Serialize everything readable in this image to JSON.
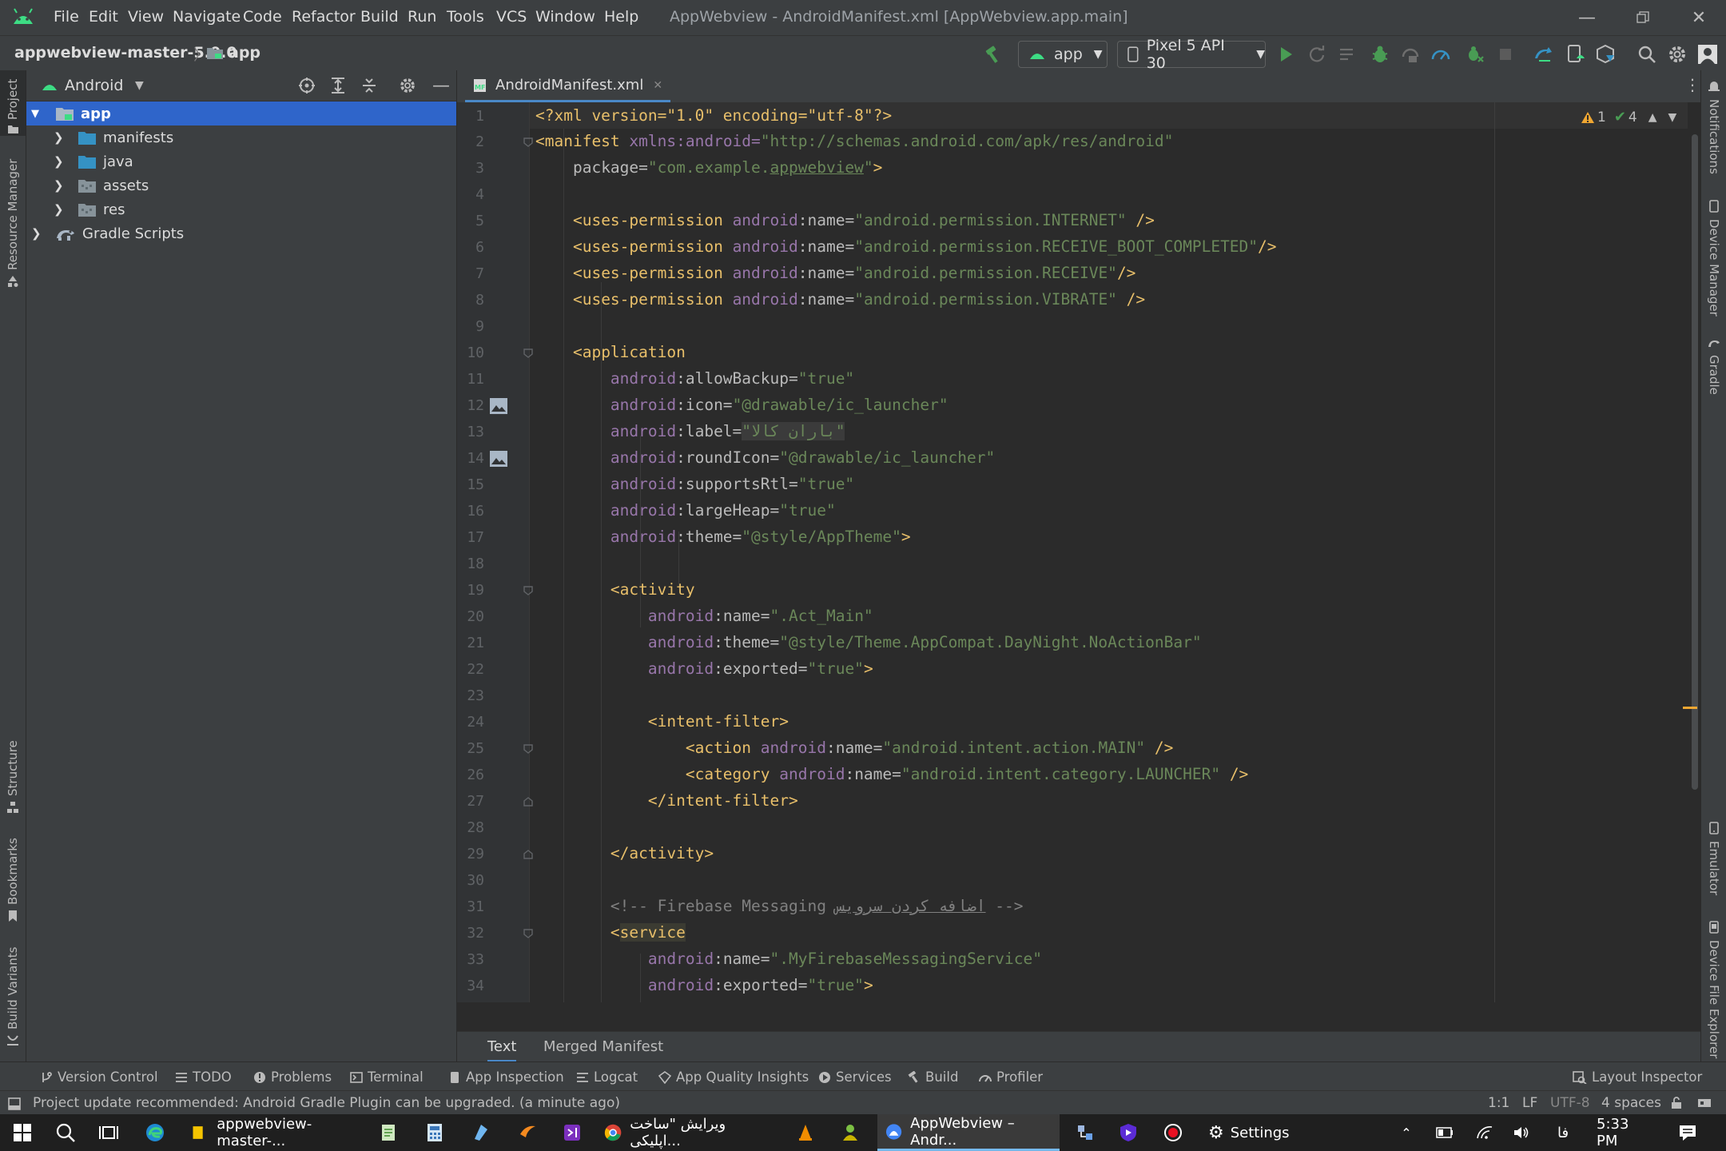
{
  "menu": [
    "File",
    "Edit",
    "View",
    "Navigate",
    "Code",
    "Refactor",
    "Build",
    "Run",
    "Tools",
    "VCS",
    "Window",
    "Help"
  ],
  "window_title": "AppWebview - AndroidManifest.xml [AppWebview.app.main]",
  "breadcrumb": {
    "root": "appwebview-master-5.0.0",
    "module": "app"
  },
  "run_config": "app",
  "device": "Pixel 5 API 30",
  "project_view": "Android",
  "tree": [
    {
      "label": "app",
      "depth": 0,
      "kind": "module",
      "expanded": true,
      "selected": true
    },
    {
      "label": "manifests",
      "depth": 1,
      "kind": "folder"
    },
    {
      "label": "java",
      "depth": 1,
      "kind": "folder"
    },
    {
      "label": "assets",
      "depth": 1,
      "kind": "folder-gray"
    },
    {
      "label": "res",
      "depth": 1,
      "kind": "folder-gray"
    },
    {
      "label": "Gradle Scripts",
      "depth": 0,
      "kind": "gradle"
    }
  ],
  "left_stripe": [
    "Project",
    "Resource Manager",
    "Structure",
    "Bookmarks",
    "Build Variants"
  ],
  "right_stripe": [
    "Notifications",
    "Device Manager",
    "Gradle",
    "Emulator",
    "Device File Explorer"
  ],
  "editor_tab": "AndroidManifest.xml",
  "inspection": {
    "warnings": "1",
    "checks": "4"
  },
  "code_lines": [
    "1",
    "2",
    "3",
    "4",
    "5",
    "6",
    "7",
    "8",
    "9",
    "10",
    "11",
    "12",
    "13",
    "14",
    "15",
    "16",
    "17",
    "18",
    "19",
    "20",
    "21",
    "22",
    "23",
    "24",
    "25",
    "26",
    "27",
    "28",
    "29",
    "30",
    "31",
    "32",
    "33",
    "34"
  ],
  "code": {
    "l1": "<?xml version=\"1.0\" encoding=\"utf-8\"?>",
    "l2_tag": "<manifest",
    "l2_ns": "xmlns:android=",
    "l2_val": "\"http://schemas.android.com/apk/res/android\"",
    "l3_attr": "package=",
    "l3_val_a": "\"com.example.",
    "l3_val_b": "appwebview",
    "l3_val_c": "\"",
    "perm_tag": "<uses-permission",
    "perm_ns": "android",
    "perm_attr": ":name=",
    "perm1": "\"android.permission.INTERNET\"",
    "perm2": "\"android.permission.RECEIVE_BOOT_COMPLETED\"",
    "perm3": "\"android.permission.RECEIVE\"",
    "perm4": "\"android.permission.VIBRATE\"",
    "application": "<application",
    "a_allowBackup": ":allowBackup=",
    "v_allowBackup": "\"true\"",
    "a_icon": ":icon=",
    "v_icon": "\"@drawable/ic_launcher\"",
    "a_label": ":label=",
    "v_label": "\"باران کالا\"",
    "a_roundIcon": ":roundIcon=",
    "v_roundIcon": "\"@drawable/ic_launcher\"",
    "a_supportsRtl": ":supportsRtl=",
    "v_supportsRtl": "\"true\"",
    "a_largeHeap": ":largeHeap=",
    "v_largeHeap": "\"true\"",
    "a_theme": ":theme=",
    "v_theme": "\"@style/AppTheme\"",
    "activity": "<activity",
    "v_act_name": "\".Act_Main\"",
    "a_exported": ":exported=",
    "v_act_theme": "\"@style/Theme.AppCompat.DayNight.NoActionBar\"",
    "v_exported": "\"true\"",
    "intent_filter": "<intent-filter>",
    "action_tag": "<action",
    "v_action": "\"android.intent.action.MAIN\"",
    "category_tag": "<category",
    "v_category": "\"android.intent.category.LAUNCHER\"",
    "intent_filter_end": "</intent-filter>",
    "activity_end": "</activity>",
    "comment_a": "<!-- Firebase Messaging ",
    "comment_b": "اضافه کردن سرویس",
    "comment_c": " -->",
    "service_lt": "<",
    "service": "service",
    "v_service_name": "\".MyFirebaseMessagingService\"",
    "close_self": " />",
    "close_self_tight": "/>",
    "close_gt": ">",
    "close_q": "?>"
  },
  "editor_bottom_tabs": [
    "Text",
    "Merged Manifest"
  ],
  "tool_windows": [
    "Version Control",
    "TODO",
    "Problems",
    "Terminal",
    "App Inspection",
    "Logcat",
    "App Quality Insights",
    "Services",
    "Build",
    "Profiler"
  ],
  "layout_inspector": "Layout Inspector",
  "status": {
    "message": "Project update recommended: Android Gradle Plugin can be upgraded. (a minute ago)",
    "position": "1:1",
    "line_sep": "LF",
    "encoding": "UTF-8",
    "indent": "4 spaces"
  },
  "taskbar": {
    "items": [
      "appwebview-master-...",
      "ویرایش \"ساخت اپلیکی...",
      "AppWebview – Andr...",
      "Settings"
    ],
    "lang": "فا",
    "time": "5:33 PM"
  },
  "colors": {
    "accent": "#2f65ca",
    "tag": "#e8bf6a",
    "value": "#6a8759",
    "namespace": "#9876aa",
    "comment": "#808080"
  }
}
